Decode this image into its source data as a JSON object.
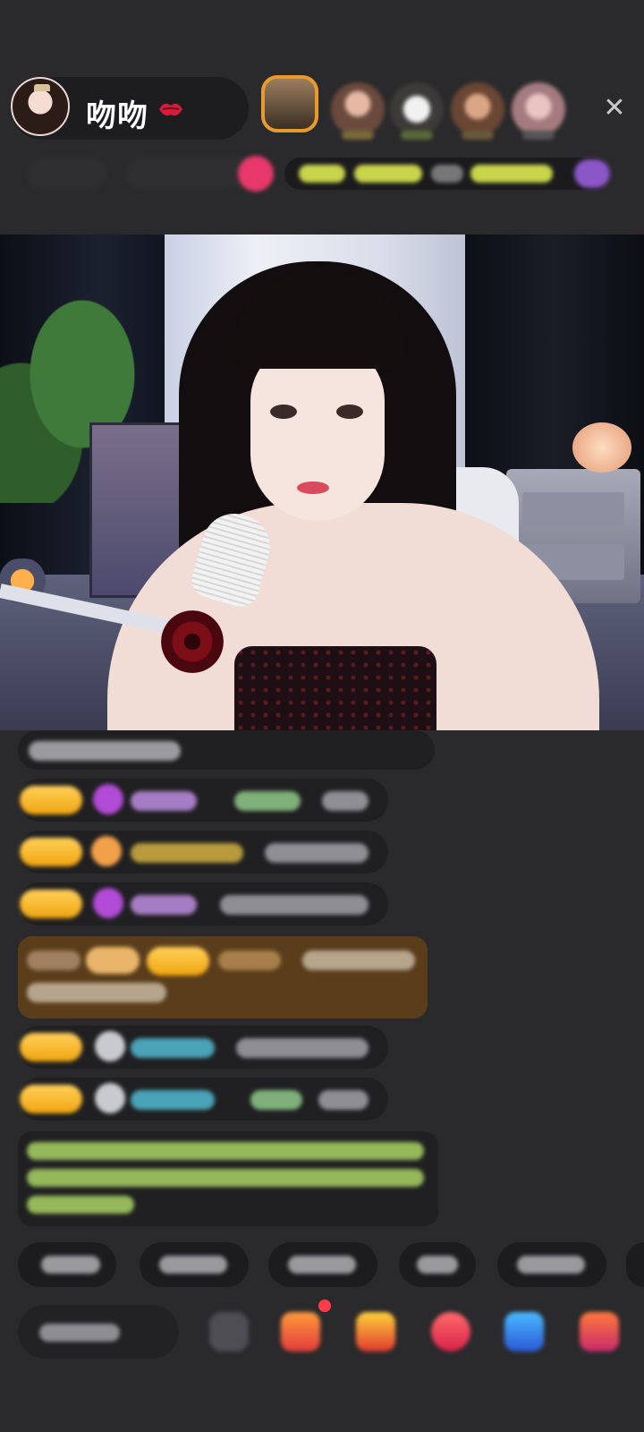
{
  "app": "live-stream-room",
  "host": {
    "name": "吻吻",
    "emoji_icon": "kiss-mark-icon"
  },
  "header": {
    "viewer_icons": [
      "viewer-avatar-1",
      "viewer-avatar-2",
      "viewer-avatar-3",
      "viewer-avatar-4",
      "viewer-avatar-5"
    ],
    "close_icon": "close-icon"
  },
  "colors": {
    "background": "#2a2a2c",
    "chat_bubble": "#202022",
    "fan_badge": "#f0a410",
    "gift_highlight": "#5a3e1c",
    "system_text": "#94b85a",
    "accent_pink": "#e8386b"
  },
  "chat": {
    "messages": [
      {
        "type": "text"
      },
      {
        "type": "fan",
        "badge_icon": "diamond-icon",
        "badge_color": "#b24bd6"
      },
      {
        "type": "fan",
        "badge_icon": "balloon-icon",
        "badge_color": "#f2a14a"
      },
      {
        "type": "fan",
        "badge_icon": "diamond-icon",
        "badge_color": "#b24bd6"
      },
      {
        "type": "gift-highlight"
      },
      {
        "type": "fan",
        "badge_icon": "bear-icon",
        "badge_color": "#c9cacd"
      },
      {
        "type": "fan",
        "badge_icon": "bear-icon",
        "badge_color": "#c9cacd"
      },
      {
        "type": "system-notice"
      }
    ]
  },
  "quick_replies": {
    "count": 6
  },
  "bottom_bar": {
    "input_icon": "comment-input",
    "buttons": [
      "emoji-icon",
      "gift-box-icon",
      "treasure-chest-icon",
      "lucky-bag-icon",
      "game-controller-icon",
      "more-gifts-icon"
    ]
  }
}
